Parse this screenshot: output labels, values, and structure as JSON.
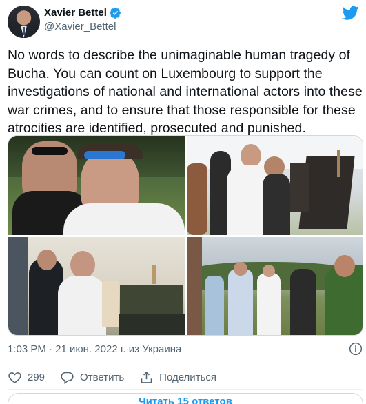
{
  "author": {
    "name": "Xavier Bettel",
    "handle": "@Xavier_Bettel"
  },
  "icons": {
    "verified": "verified-badge-icon",
    "platform": "twitter-bird-icon",
    "info": "info-icon",
    "like": "heart-icon",
    "reply": "speech-bubble-icon",
    "share": "share-upload-icon"
  },
  "colors": {
    "accent": "#1d9bf0",
    "text": "#0f1419",
    "secondary_text": "#536471",
    "border": "#cfd9de"
  },
  "tweet": {
    "text": "No words to describe the unimaginable human tragedy of Bucha. You can count on Luxembourg to support the investigations of national and international actors into these war crimes, and to ensure that those responsible for these atrocities are identified, prosecuted and punished.",
    "meta": "1:03 PM · 21 июн. 2022 г. из Украина"
  },
  "actions": {
    "like_count": "299",
    "reply_label": "Ответить",
    "share_label": "Поделиться"
  },
  "footer": {
    "read_replies": "Читать 15 ответов"
  }
}
